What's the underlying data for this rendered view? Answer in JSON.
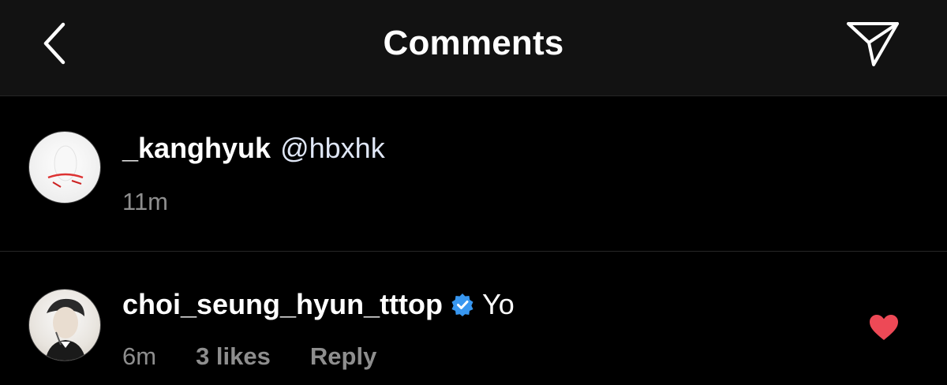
{
  "header": {
    "title": "Comments",
    "back_icon": "chevron-left-icon",
    "share_icon": "paper-plane-icon"
  },
  "comments": [
    {
      "username": "_kanghyuk",
      "mention": "@hbxhk",
      "text": "",
      "time": "11m",
      "likes": "",
      "reply": "",
      "verified": false,
      "liked": false
    },
    {
      "username": "choi_seung_hyun_tttop",
      "mention": "",
      "text": "Yo",
      "time": "6m",
      "likes": "3 likes",
      "reply": "Reply",
      "verified": true,
      "liked": true
    }
  ],
  "colors": {
    "background": "#000000",
    "header_bg": "#121212",
    "secondary_text": "#8e8e8e",
    "verified_blue": "#3897f0",
    "heart_red": "#ed4956"
  }
}
